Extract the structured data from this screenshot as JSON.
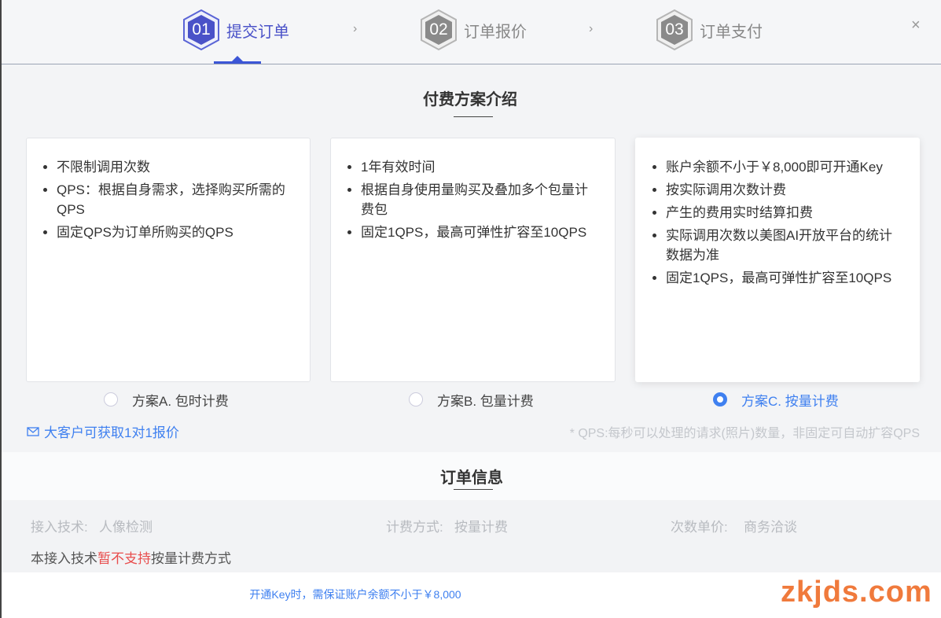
{
  "steps": [
    {
      "num": "01",
      "label": "提交订单",
      "active": true
    },
    {
      "num": "02",
      "label": "订单报价",
      "active": false
    },
    {
      "num": "03",
      "label": "订单支付",
      "active": false
    }
  ],
  "arrow": "›",
  "close": "×",
  "plan_section": {
    "title": "付费方案介绍"
  },
  "cards": [
    {
      "items": [
        "不限制调用次数",
        "QPS：根据自身需求，选择购买所需的QPS",
        "固定QPS为订单所购买的QPS"
      ]
    },
    {
      "items": [
        "1年有效时间",
        "根据自身使用量购买及叠加多个包量计费包",
        "固定1QPS，最高可弹性扩容至10QPS"
      ]
    },
    {
      "items": [
        "账户余额不小于￥8,000即可开通Key",
        "按实际调用次数计费",
        "产生的费用实时结算扣费",
        "实际调用次数以美图AI开放平台的统计数据为准",
        "固定1QPS，最高可弹性扩容至10QPS"
      ]
    }
  ],
  "options": [
    {
      "label": "方案A. 包时计费",
      "selected": false
    },
    {
      "label": "方案B. 包量计费",
      "selected": false
    },
    {
      "label": "方案C. 按量计费",
      "selected": true
    }
  ],
  "quote_link": "大客户可获取1对1报价",
  "qps_note": "* QPS:每秒可以处理的请求(照片)数量，非固定可自动扩容QPS",
  "order_section": {
    "title": "订单信息"
  },
  "order": {
    "tech_label": "接入技术:",
    "tech_value": "人像检测",
    "billing_label": "计费方式:",
    "billing_value": "按量计费",
    "unit_label": "次数单价:",
    "unit_value": "商务洽谈",
    "warning_prefix": "本接入技术",
    "warning_highlight": "暂不支持",
    "warning_suffix": "按量计费方式"
  },
  "footer_note": "开通Key时，需保证账户余额不小于￥8,000",
  "watermark": "zkjds.com",
  "colors": {
    "accent": "#3f80f0",
    "step_active": "#4a52c8",
    "warning": "#e84c4c",
    "watermark": "#f07a3c"
  }
}
